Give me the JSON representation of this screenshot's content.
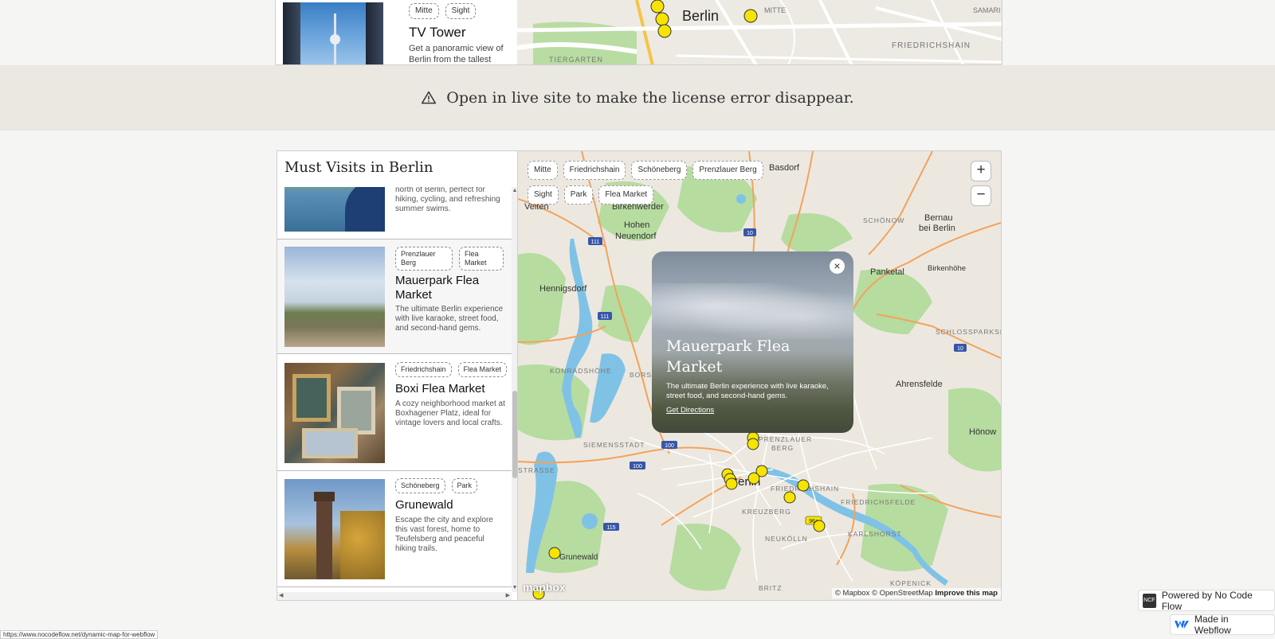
{
  "top_widget": {
    "tags": [
      "Mitte",
      "Sight"
    ],
    "title": "TV Tower",
    "description": "Get a panoramic view of Berlin from the tallest",
    "map_labels": {
      "city": "Berlin",
      "district_a": "TIERGARTEN",
      "district_b": "MITTE",
      "district_c": "FRIEDRICHSHAIN",
      "district_d": "SAMARI QUART"
    }
  },
  "banner": {
    "text": "Open in live site to make the license error disappear."
  },
  "list": {
    "heading": "Must Visits in Berlin",
    "cards": [
      {
        "tags": [],
        "title": "",
        "description": "north of Berlin, perfect for hiking, cycling, and refreshing summer swims."
      },
      {
        "tags": [
          "Prenzlauer Berg",
          "Flea Market"
        ],
        "title": "Mauerpark Flea Market",
        "description": "The ultimate Berlin experience with live karaoke, street food, and second-hand gems."
      },
      {
        "tags": [
          "Friedrichshain",
          "Flea Market"
        ],
        "title": "Boxi Flea Market",
        "description": "A cozy neighborhood market at Boxhagener Platz, ideal for vintage lovers and local crafts."
      },
      {
        "tags": [
          "Schöneberg",
          "Park"
        ],
        "title": "Grunewald",
        "description": "Escape the city and explore this vast forest, home to Teufelsberg and peaceful hiking trails."
      }
    ]
  },
  "map": {
    "filters": [
      "Mitte",
      "Friedrichshain",
      "Schöneberg",
      "Prenzlauer Berg",
      "Sight",
      "Park",
      "Flea Market"
    ],
    "zoom_in": "+",
    "zoom_out": "−",
    "labels": {
      "basdorf": "Basdorf",
      "birkenwerder": "Birkenwerder",
      "velten": "Velten",
      "hohen": "Hohen",
      "neuendorf": "Neuendorf",
      "hennigsdorf": "Hennigsdorf",
      "schoenow": "SCHÖNOW",
      "bernau": "Bernau",
      "bei_berlin": "bei Berlin",
      "panketal": "Panketal",
      "birkenhoehe": "Birkenhöhe",
      "schlossparksied": "SCHLOSSPARKSIED",
      "ahrensfelde": "Ahrensfelde",
      "hoenow": "Hönow",
      "konradshoehe": "KONRADSHÖHE",
      "borsi": "BORSI",
      "siemensstadt": "SIEMENSSTADT",
      "strasse": "STRASSE",
      "prenzlauer": "PRENZLAUER",
      "berg": "BERG",
      "friedrichshain": "FRIEDRICHSHAIN",
      "friedrichsfelde": "FRIEDRICHSFELDE",
      "kreuzberg": "KREUZBERG",
      "neukoelln": "NEUKÖLLN",
      "karlshorst": "KARLSHORST",
      "grunewald": "Grunewald",
      "britz": "BRITZ",
      "koepenick": "KÖPENICK",
      "city": "Berlin"
    },
    "road_shields": [
      "111",
      "111",
      "10",
      "10",
      "100",
      "100",
      "115",
      "96a"
    ],
    "popup": {
      "close": "×",
      "title": "Mauerpark Flea Market",
      "description": "The ultimate Berlin experience with live karaoke, street food, and second-hand gems.",
      "link": "Get Directions"
    },
    "logo": "mapbox",
    "attribution": "© Mapbox © OpenStreetMap",
    "improve": "Improve this map"
  },
  "badges": {
    "ncf": "Powered by No Code Flow",
    "ncf_logo": "NCF",
    "webflow": "Made in Webflow"
  },
  "status_url": "https://www.nocodeflow.net/dynamic-map-for-webflow",
  "colors": {
    "marker": "#f7e400",
    "water": "#7fc2e6",
    "park": "#b6dca0",
    "road": "#f5a25a",
    "land": "#ece8e0"
  }
}
